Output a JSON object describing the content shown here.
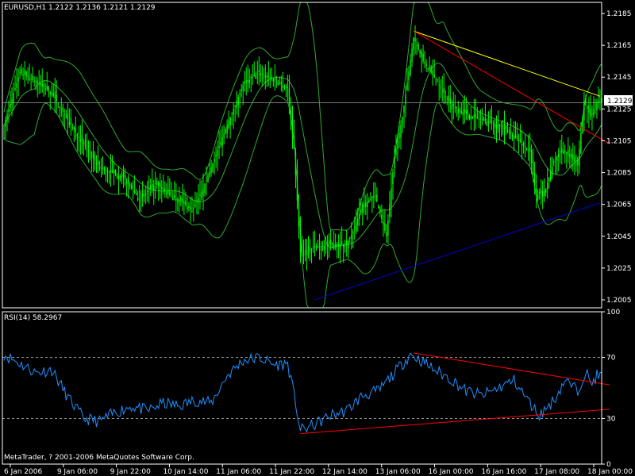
{
  "main_header": "EURUSD,H1  1.2122 1.2136 1.2121 1.2129",
  "rsi_header": "RSI(14) 58.2967",
  "footer": "MetaTrader, ? 2001-2006 MetaQuotes Software Corp.",
  "price_tag": "1.2129",
  "colors": {
    "background": "#000000",
    "axis": "#ffffff",
    "candle": "#00ff00",
    "bands": "#2fa82f",
    "rsi_line": "#1e90ff",
    "trend_red": "#ff0000",
    "trend_yellow": "#ffff00",
    "trend_blue": "#0000cc",
    "level_dash": "#c0c0c0"
  },
  "chart_data": [
    {
      "type": "candlestick",
      "title": "EURUSD,H1",
      "ohlc_last": {
        "open": 1.2122,
        "high": 1.2136,
        "low": 1.2121,
        "close": 1.2129
      },
      "y_ticks": [
        "1.2185",
        "1.2165",
        "1.2145",
        "1.2125",
        "1.2105",
        "1.2085",
        "1.2065",
        "1.2045",
        "1.2025",
        "1.2005"
      ],
      "ylim": [
        1.2,
        1.2192
      ],
      "current_price": 1.2129,
      "x_tick_labels": [
        "6 Jan 2006",
        "9 Jan 06:00",
        "9 Jan 22:00",
        "10 Jan 14:00",
        "11 Jan 06:00",
        "11 Jan 22:00",
        "12 Jan 14:00",
        "13 Jan 06:00",
        "16 Jan 00:00",
        "16 Jan 16:00",
        "17 Jan 08:00",
        "18 Jan 00:00"
      ],
      "bars": 250,
      "approx_close_series": [
        [
          0,
          1.2115
        ],
        [
          10,
          1.2148
        ],
        [
          20,
          1.2142
        ],
        [
          30,
          1.2135
        ],
        [
          40,
          1.2118
        ],
        [
          60,
          1.2088
        ],
        [
          75,
          1.2082
        ],
        [
          85,
          1.2068
        ],
        [
          95,
          1.2078
        ],
        [
          105,
          1.207
        ],
        [
          110,
          1.2068
        ],
        [
          118,
          1.2061
        ],
        [
          125,
          1.2075
        ],
        [
          140,
          1.2115
        ],
        [
          150,
          1.214
        ],
        [
          160,
          1.2148
        ],
        [
          170,
          1.2143
        ],
        [
          178,
          1.2138
        ],
        [
          182,
          1.21
        ],
        [
          186,
          1.2035
        ],
        [
          195,
          1.2038
        ],
        [
          205,
          1.204
        ],
        [
          215,
          1.204
        ],
        [
          220,
          1.205
        ],
        [
          225,
          1.2065
        ],
        [
          233,
          1.207
        ],
        [
          240,
          1.2045
        ],
        [
          245,
          1.2095
        ],
        [
          250,
          1.212
        ],
        [
          257,
          1.217
        ],
        [
          263,
          1.2155
        ],
        [
          272,
          1.2142
        ],
        [
          280,
          1.2128
        ],
        [
          290,
          1.2122
        ],
        [
          300,
          1.2118
        ],
        [
          310,
          1.2115
        ],
        [
          320,
          1.2108
        ],
        [
          330,
          1.2098
        ],
        [
          334,
          1.207
        ],
        [
          340,
          1.2075
        ],
        [
          345,
          1.2092
        ],
        [
          350,
          1.21
        ],
        [
          355,
          1.2095
        ],
        [
          360,
          1.209
        ],
        [
          364,
          1.213
        ],
        [
          368,
          1.212
        ],
        [
          372,
          1.2129
        ]
      ],
      "bollinger_bands": true,
      "trend_lines": [
        {
          "color": "trend_yellow",
          "from": {
            "x": 257,
            "y": 1.2174
          },
          "to": {
            "x": 374,
            "y": 1.2133
          }
        },
        {
          "color": "trend_red",
          "from": {
            "x": 257,
            "y": 1.2174
          },
          "to": {
            "x": 380,
            "y": 1.2103
          }
        },
        {
          "color": "trend_blue",
          "from": {
            "x": 195,
            "y": 1.2005
          },
          "to": {
            "x": 374,
            "y": 1.2066
          }
        }
      ]
    },
    {
      "type": "line",
      "title": "RSI(14)",
      "current_value": 58.2967,
      "y_ticks": [
        "100",
        "70",
        "30",
        "0"
      ],
      "ylim": [
        0,
        100
      ],
      "levels": [
        70,
        30
      ],
      "series": [
        {
          "values": [
            [
              0,
              72
            ],
            [
              10,
              66
            ],
            [
              20,
              60
            ],
            [
              30,
              62
            ],
            [
              40,
              44
            ],
            [
              50,
              30
            ],
            [
              60,
              28
            ],
            [
              70,
              34
            ],
            [
              80,
              38
            ],
            [
              90,
              35
            ],
            [
              100,
              40
            ],
            [
              110,
              38
            ],
            [
              120,
              42
            ],
            [
              130,
              40
            ],
            [
              140,
              58
            ],
            [
              150,
              68
            ],
            [
              160,
              70
            ],
            [
              170,
              65
            ],
            [
              178,
              66
            ],
            [
              183,
              40
            ],
            [
              186,
              22
            ],
            [
              195,
              26
            ],
            [
              205,
              32
            ],
            [
              215,
              35
            ],
            [
              225,
              45
            ],
            [
              235,
              48
            ],
            [
              245,
              60
            ],
            [
              255,
              72
            ],
            [
              262,
              68
            ],
            [
              270,
              62
            ],
            [
              280,
              56
            ],
            [
              290,
              48
            ],
            [
              300,
              45
            ],
            [
              310,
              50
            ],
            [
              320,
              55
            ],
            [
              330,
              40
            ],
            [
              336,
              32
            ],
            [
              345,
              42
            ],
            [
              352,
              55
            ],
            [
              360,
              48
            ],
            [
              365,
              62
            ],
            [
              368,
              52
            ],
            [
              372,
              58
            ]
          ]
        }
      ],
      "trend_lines": [
        {
          "color": "trend_red",
          "from": {
            "x": 257,
            "y": 73
          },
          "to": {
            "x": 380,
            "y": 52
          }
        },
        {
          "color": "trend_red",
          "from": {
            "x": 186,
            "y": 20
          },
          "to": {
            "x": 380,
            "y": 36
          }
        }
      ]
    }
  ]
}
